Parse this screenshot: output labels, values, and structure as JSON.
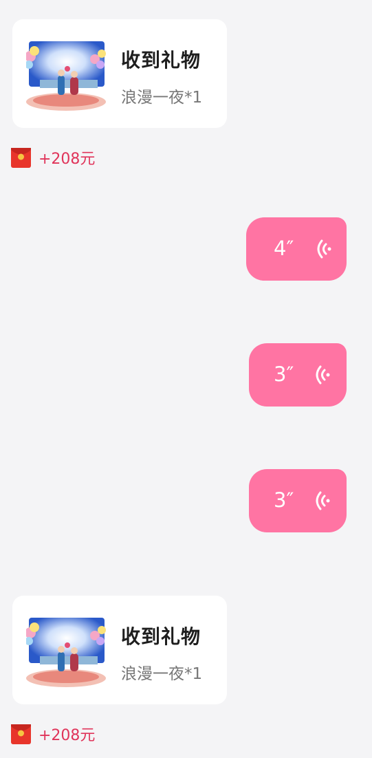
{
  "colors": {
    "background": "#f4f4f6",
    "card": "#ffffff",
    "voice_bubble": "#ff74a3",
    "reward_text": "#e0345a",
    "hongbao_red": "#e8352b",
    "hongbao_gold": "#f6c542"
  },
  "messages": [
    {
      "type": "gift",
      "title": "收到礼物",
      "description": "浪漫一夜*1",
      "reward": "+208元",
      "image_icon": "romantic-night-gift-image",
      "reward_icon": "red-envelope-icon"
    },
    {
      "type": "voice",
      "duration": "4″",
      "icon": "voice-wave-icon"
    },
    {
      "type": "voice",
      "duration": "3″",
      "icon": "voice-wave-icon"
    },
    {
      "type": "voice",
      "duration": "3″",
      "icon": "voice-wave-icon"
    },
    {
      "type": "gift",
      "title": "收到礼物",
      "description": "浪漫一夜*1",
      "reward": "+208元",
      "image_icon": "romantic-night-gift-image",
      "reward_icon": "red-envelope-icon"
    }
  ]
}
